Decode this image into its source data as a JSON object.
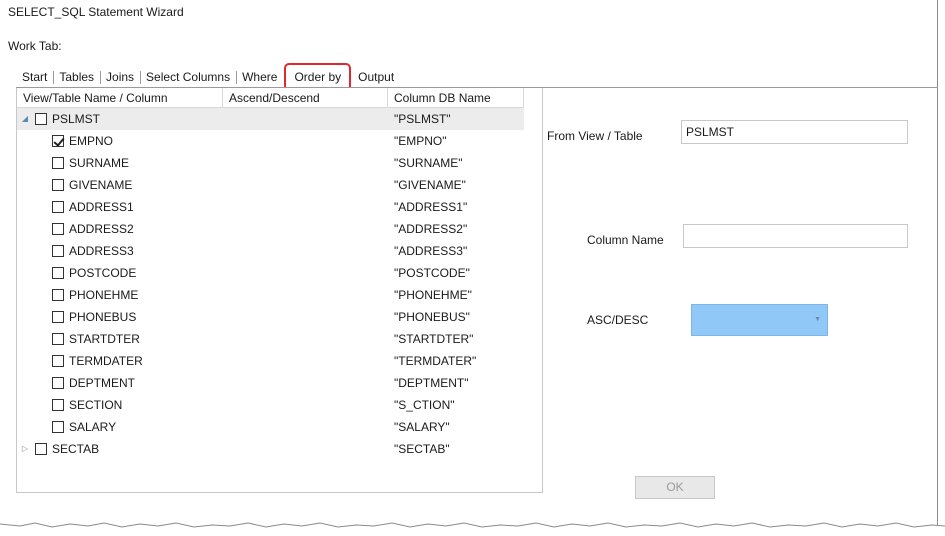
{
  "window": {
    "title": "SELECT_SQL Statement Wizard",
    "work_tab_label": "Work Tab:"
  },
  "tabs": [
    {
      "label": "Start"
    },
    {
      "label": "Tables"
    },
    {
      "label": "Joins"
    },
    {
      "label": "Select Columns"
    },
    {
      "label": "Where"
    },
    {
      "label": "Order by",
      "active": true
    },
    {
      "label": "Output"
    }
  ],
  "tree": {
    "headers": {
      "name": "View/Table Name  /  Column",
      "order": "Ascend/Descend",
      "db": "Column DB Name"
    },
    "rows": [
      {
        "name": "PSLMST",
        "db": "\"PSLMST\"",
        "level": 0,
        "expanded": true,
        "checked": false,
        "selected": true
      },
      {
        "name": "EMPNO",
        "db": "\"EMPNO\"",
        "level": 1,
        "checked": true
      },
      {
        "name": "SURNAME",
        "db": "\"SURNAME\"",
        "level": 1,
        "checked": false
      },
      {
        "name": "GIVENAME",
        "db": "\"GIVENAME\"",
        "level": 1,
        "checked": false
      },
      {
        "name": "ADDRESS1",
        "db": "\"ADDRESS1\"",
        "level": 1,
        "checked": false
      },
      {
        "name": "ADDRESS2",
        "db": "\"ADDRESS2\"",
        "level": 1,
        "checked": false
      },
      {
        "name": "ADDRESS3",
        "db": "\"ADDRESS3\"",
        "level": 1,
        "checked": false
      },
      {
        "name": "POSTCODE",
        "db": "\"POSTCODE\"",
        "level": 1,
        "checked": false
      },
      {
        "name": "PHONEHME",
        "db": "\"PHONEHME\"",
        "level": 1,
        "checked": false
      },
      {
        "name": "PHONEBUS",
        "db": "\"PHONEBUS\"",
        "level": 1,
        "checked": false
      },
      {
        "name": "STARTDTER",
        "db": "\"STARTDTER\"",
        "level": 1,
        "checked": false
      },
      {
        "name": "TERMDATER",
        "db": "\"TERMDATER\"",
        "level": 1,
        "checked": false
      },
      {
        "name": "DEPTMENT",
        "db": "\"DEPTMENT\"",
        "level": 1,
        "checked": false
      },
      {
        "name": "SECTION",
        "db": "\"S_CTION\"",
        "level": 1,
        "checked": false
      },
      {
        "name": "SALARY",
        "db": "\"SALARY\"",
        "level": 1,
        "checked": false
      },
      {
        "name": "SECTAB",
        "db": "\"SECTAB\"",
        "level": 0,
        "expanded": false,
        "checked": false
      }
    ]
  },
  "form": {
    "from_label": "From View / Table",
    "from_value": "PSLMST",
    "column_label": "Column Name",
    "column_value": "",
    "ascdesc_label": "ASC/DESC",
    "ascdesc_value": "",
    "ascdesc_color": "#90c8f8",
    "ok_label": "OK"
  },
  "colors": {
    "active_tab_outline": "#e0282e",
    "selected_row": "#ececec"
  }
}
